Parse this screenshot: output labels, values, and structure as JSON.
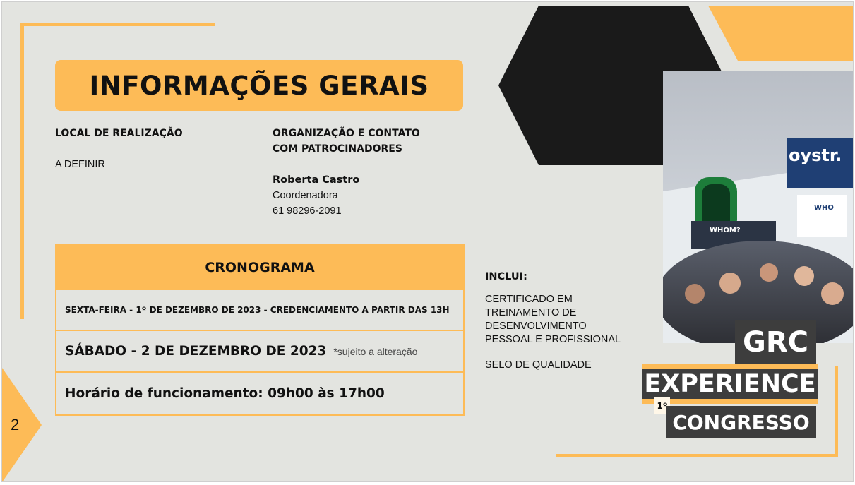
{
  "page_number": "2",
  "title": "INFORMAÇÕES GERAIS",
  "local": {
    "label": "LOCAL DE REALIZAÇÃO",
    "value": "A DEFINIR"
  },
  "organizacao": {
    "label_line1": "ORGANIZAÇÃO E CONTATO",
    "label_line2": "COM PATROCINADORES",
    "name": "Roberta Castro",
    "role": "Coordenadora",
    "phone": "61 98296-2091"
  },
  "cronograma": {
    "header": "CRONOGRAMA",
    "row1": "SEXTA-FEIRA - 1º DE DEZEMBRO DE 2023 - CREDENCIAMENTO A PARTIR DAS 13H",
    "row2_main": "SÁBADO - 2 DE DEZEMBRO DE 2023",
    "row2_note": "*sujeito a alteração",
    "row3": "Horário de funcionamento: 09h00 às 17h00"
  },
  "inclui": {
    "label": "INCLUI:",
    "items": [
      "CERTIFICADO EM",
      "TREINAMENTO DE",
      "DESENVOLVIMENTO",
      "PESSOAL E PROFISSIONAL"
    ],
    "item2": "SELO DE QUALIDADE"
  },
  "brand": {
    "line1": "GRC",
    "line2": "EXPERIENCE",
    "ordinal": "1º",
    "line3": "CONGRESSO"
  },
  "photo_signs": {
    "sign1": "oystr.",
    "sign2": "WHOM?",
    "sign3": "WHO"
  },
  "colors": {
    "accent": "#fdbb57",
    "background": "#e3e4e0",
    "dark": "#1a1a1a",
    "label_bg": "#3d3d3d"
  }
}
